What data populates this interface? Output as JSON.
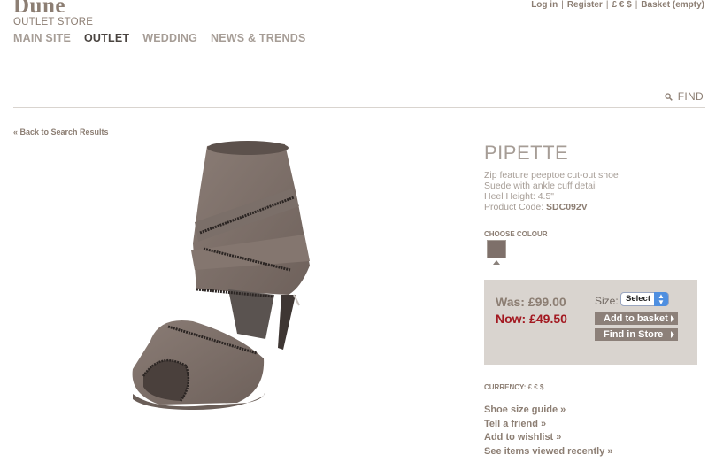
{
  "brand": {
    "name": "Dune",
    "sub": "OUTLET STORE"
  },
  "utility": {
    "login": "Log in",
    "register": "Register",
    "currency": "£ € $",
    "basket": "Basket (empty)",
    "sep": "|"
  },
  "nav": [
    {
      "label": "MAIN SITE",
      "active": false
    },
    {
      "label": "OUTLET",
      "active": true
    },
    {
      "label": "WEDDING",
      "active": false
    },
    {
      "label": "NEWS & TRENDS",
      "active": false
    }
  ],
  "find": {
    "label": "FIND",
    "icon": "search-icon"
  },
  "back": "« Back to Search Results",
  "product": {
    "name": "PIPETTE",
    "desc1": "Zip feature peeptoe cut-out shoe",
    "desc2": "Suede with ankle cuff detail",
    "desc3": "Heel Height: 4.5\"",
    "code_label": "Product Code: ",
    "code": "SDC092V",
    "image": "shoe-image"
  },
  "colour": {
    "label": "CHOOSE COLOUR",
    "swatch": "#7e706a"
  },
  "pricing": {
    "was": "Was: £99.00",
    "now": "Now: £49.50",
    "size_label": "Size:",
    "size_value": "Select",
    "add_basket": "Add to basket",
    "find_store": "Find in Store"
  },
  "currency": "CURRENCY: £ € $",
  "links": [
    "Shoe size guide »",
    "Tell a friend »",
    "Add to wishlist »",
    "See items viewed recently »"
  ],
  "colors": {
    "accent": "#8c7e73",
    "sale": "#a31921",
    "panel": "#d9d4cf"
  }
}
